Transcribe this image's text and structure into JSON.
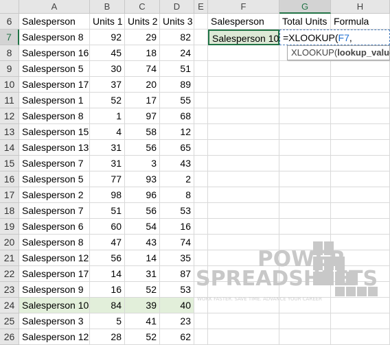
{
  "sheet": {
    "columns": [
      "A",
      "B",
      "C",
      "D",
      "E",
      "F",
      "G",
      "H"
    ],
    "selected_column": "G",
    "active_row": "7",
    "header_row": {
      "row": "6",
      "a": "Salesperson",
      "b": "Units 1",
      "c": "Units 2",
      "d": "Units 3",
      "f": "Salesperson",
      "g": "Total Units",
      "h": "Formula"
    },
    "rows": [
      {
        "row": "7",
        "name": "Salesperson 8",
        "u1": "92",
        "u2": "29",
        "u3": "82"
      },
      {
        "row": "8",
        "name": "Salesperson 16",
        "u1": "45",
        "u2": "18",
        "u3": "24"
      },
      {
        "row": "9",
        "name": "Salesperson 5",
        "u1": "30",
        "u2": "74",
        "u3": "51"
      },
      {
        "row": "10",
        "name": "Salesperson 17",
        "u1": "37",
        "u2": "20",
        "u3": "89"
      },
      {
        "row": "11",
        "name": "Salesperson 1",
        "u1": "52",
        "u2": "17",
        "u3": "55"
      },
      {
        "row": "12",
        "name": "Salesperson 8",
        "u1": "1",
        "u2": "97",
        "u3": "68"
      },
      {
        "row": "13",
        "name": "Salesperson 15",
        "u1": "4",
        "u2": "58",
        "u3": "12"
      },
      {
        "row": "14",
        "name": "Salesperson 13",
        "u1": "31",
        "u2": "56",
        "u3": "65"
      },
      {
        "row": "15",
        "name": "Salesperson 7",
        "u1": "31",
        "u2": "3",
        "u3": "43"
      },
      {
        "row": "16",
        "name": "Salesperson 5",
        "u1": "77",
        "u2": "93",
        "u3": "2"
      },
      {
        "row": "17",
        "name": "Salesperson 2",
        "u1": "98",
        "u2": "96",
        "u3": "8"
      },
      {
        "row": "18",
        "name": "Salesperson 7",
        "u1": "51",
        "u2": "56",
        "u3": "53"
      },
      {
        "row": "19",
        "name": "Salesperson 6",
        "u1": "60",
        "u2": "54",
        "u3": "16"
      },
      {
        "row": "20",
        "name": "Salesperson 8",
        "u1": "47",
        "u2": "43",
        "u3": "74"
      },
      {
        "row": "21",
        "name": "Salesperson 12",
        "u1": "56",
        "u2": "14",
        "u3": "35"
      },
      {
        "row": "22",
        "name": "Salesperson 17",
        "u1": "14",
        "u2": "31",
        "u3": "87"
      },
      {
        "row": "23",
        "name": "Salesperson 9",
        "u1": "16",
        "u2": "52",
        "u3": "53"
      },
      {
        "row": "24",
        "name": "Salesperson 10",
        "u1": "84",
        "u2": "39",
        "u3": "40",
        "highlight": true
      },
      {
        "row": "25",
        "name": "Salesperson 3",
        "u1": "5",
        "u2": "41",
        "u3": "23"
      },
      {
        "row": "26",
        "name": "Salesperson 12",
        "u1": "28",
        "u2": "52",
        "u3": "62"
      }
    ],
    "lookup": {
      "value": "Salesperson 10",
      "formula_prefix": "=XLOOKUP(",
      "formula_ref": "F7",
      "formula_suffix": ","
    },
    "tooltip": {
      "fn": "XLOOKUP(",
      "arg": "lookup_value",
      "rest": ", "
    },
    "colors": {
      "accent": "#217346",
      "highlight": "#e2efda",
      "reference": "#1f6fd1"
    }
  },
  "watermark": {
    "line1": "POWER",
    "line2": "SPREADSHEETS",
    "tagline": "WORK FASTER. SAVE TIME. ADVANCE YOUR CAREER"
  }
}
